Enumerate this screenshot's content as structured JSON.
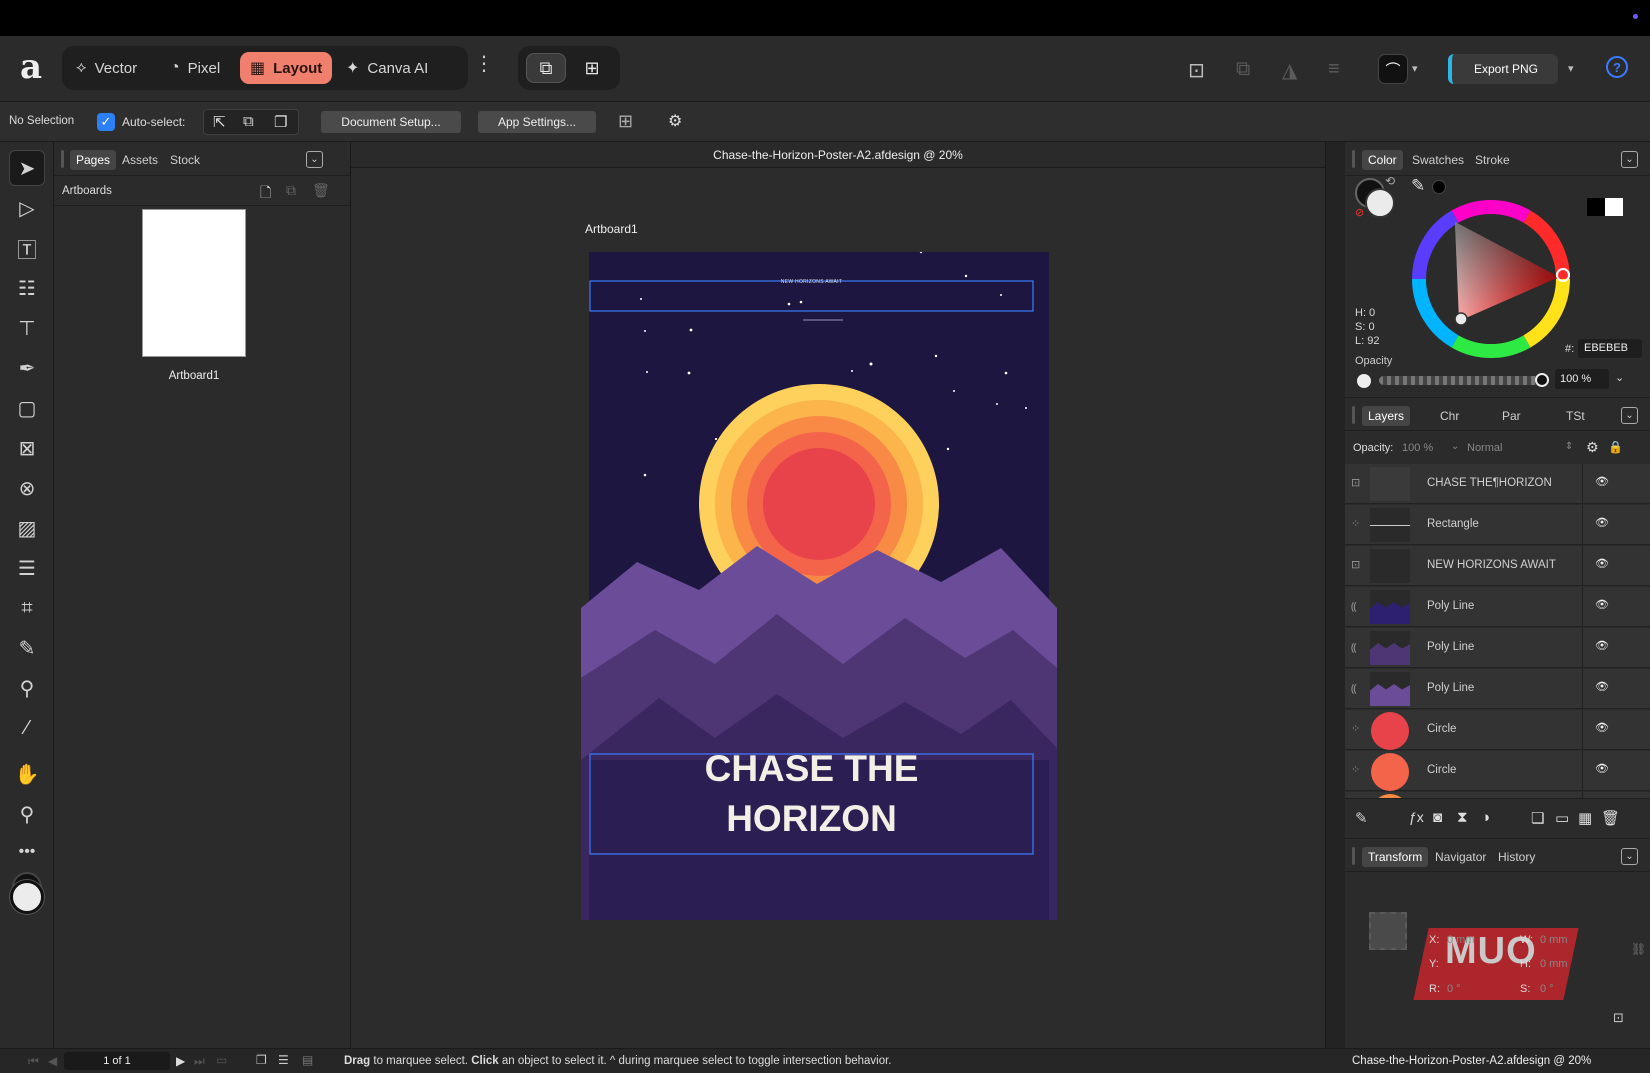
{
  "toolbar": {
    "personas": [
      {
        "label": "Vector",
        "icon": "vector-persona-icon"
      },
      {
        "label": "Pixel",
        "icon": "pixel-persona-icon"
      },
      {
        "label": "Layout",
        "icon": "layout-persona-icon"
      },
      {
        "label": "Canva AI",
        "icon": "sparkle-icon"
      }
    ],
    "export_label": "Export PNG"
  },
  "context": {
    "selection": "No Selection",
    "autoselect_label": "Auto-select:",
    "autoselect_checked": true,
    "document_setup": "Document Setup...",
    "app_settings": "App Settings..."
  },
  "pages_panel": {
    "tabs": [
      "Pages",
      "Assets",
      "Stock"
    ],
    "active_tab": "Pages",
    "section": "Artboards",
    "artboards": [
      {
        "label": "Artboard1"
      }
    ]
  },
  "document": {
    "title": "Chase-the-Horizon-Poster-A2.afdesign @ 20%",
    "artboard_label": "Artboard1",
    "poster_subtitle": "NEW HORIZONS AWAIT",
    "poster_title_line1": "CHASE THE",
    "poster_title_line2": "HORIZON"
  },
  "color_panel": {
    "tabs": [
      "Color",
      "Swatches",
      "Stroke"
    ],
    "active_tab": "Color",
    "h": "H: 0",
    "s": "S: 0",
    "l": "L: 92",
    "hex_label": "#:",
    "hex_value": "EBEBEB",
    "opacity_label": "Opacity",
    "opacity_value": "100 %",
    "opacity": 1.0
  },
  "layers_panel": {
    "tabs": [
      "Layers",
      "Chr",
      "Par",
      "TSt"
    ],
    "active_tab": "Layers",
    "opacity_label": "Opacity:",
    "opacity_value": "100 %",
    "blend_mode": "Normal",
    "layers": [
      {
        "name": "CHASE THE¶HORIZON",
        "kind": "text"
      },
      {
        "name": "Rectangle",
        "kind": "shape"
      },
      {
        "name": "NEW HORIZONS AWAIT",
        "kind": "text"
      },
      {
        "name": "Poly Line",
        "kind": "curve"
      },
      {
        "name": "Poly Line",
        "kind": "curve"
      },
      {
        "name": "Poly Line",
        "kind": "curve"
      },
      {
        "name": "Circle",
        "kind": "shape"
      },
      {
        "name": "Circle",
        "kind": "shape"
      },
      {
        "name": "Circle",
        "kind": "shape"
      }
    ]
  },
  "transform_panel": {
    "tabs": [
      "Transform",
      "Navigator",
      "History"
    ],
    "active_tab": "Transform",
    "x_label": "X:",
    "x_value": "0 mm",
    "y_label": "Y:",
    "w_label": "W:",
    "w_value": "0 mm",
    "h_label": "H:",
    "h_value": "0 mm",
    "r_label": "R:",
    "r_value": "0 °",
    "s_label": "S:",
    "s_value": "0 °",
    "watermark": "MUO"
  },
  "status": {
    "page_indicator": "1 of 1",
    "hint_drag": "Drag",
    "hint_drag_text": " to marquee select. ",
    "hint_click": "Click",
    "hint_click_text": " an object to select it. ^ during marquee select to toggle intersection behavior.",
    "right_title": "Chase-the-Horizon-Poster-A2.afdesign @ 20%"
  },
  "colors": {
    "accent": "#f07f6e",
    "selection_blue": "#2d7ff5",
    "poster_bg": "#1d1640",
    "sun_outer": "#fdd15c",
    "sun_core": "#e8434a",
    "mountain_front": "#6b4c98"
  }
}
